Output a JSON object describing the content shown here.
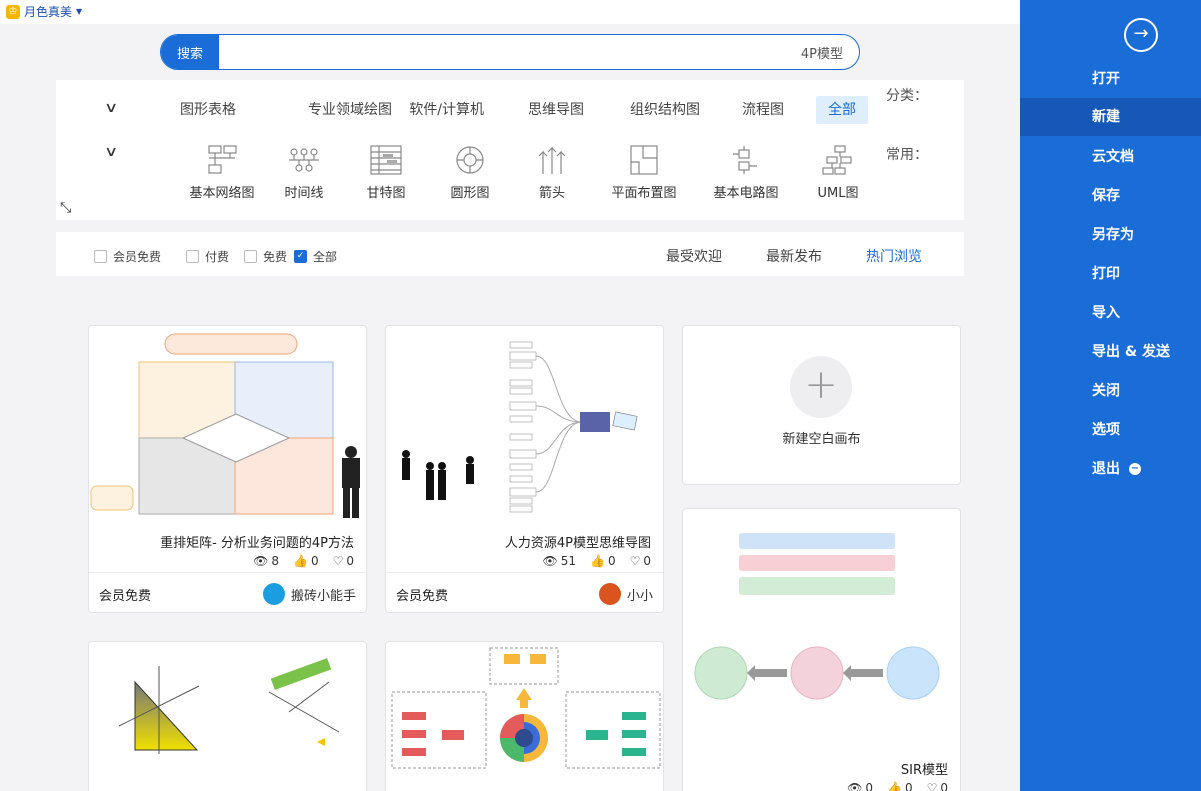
{
  "theme": {
    "label": "月色真美"
  },
  "search": {
    "button": "搜索",
    "value": "4P模型"
  },
  "categories": {
    "label": "分类：",
    "items": [
      "全部",
      "流程图",
      "组织结构图",
      "思维导图",
      "软件/计算机",
      "专业领域绘图",
      "图形表格"
    ]
  },
  "common": {
    "label": "常用：",
    "tools": [
      {
        "label": "UML图",
        "icon": "uml-icon"
      },
      {
        "label": "基本电路图",
        "icon": "circuit-icon"
      },
      {
        "label": "平面布置图",
        "icon": "floorplan-icon"
      },
      {
        "label": "箭头",
        "icon": "arrow-icon"
      },
      {
        "label": "圆形图",
        "icon": "circle-chart-icon"
      },
      {
        "label": "甘特图",
        "icon": "gantt-icon"
      },
      {
        "label": "时间线",
        "icon": "timeline-icon"
      },
      {
        "label": "基本网络图",
        "icon": "network-icon"
      }
    ]
  },
  "sort": {
    "hot": "热门浏览",
    "newest": "最新发布",
    "popular": "最受欢迎"
  },
  "filters": {
    "all": "全部",
    "free": "免费",
    "paid": "付费",
    "member": "会员免费"
  },
  "new_blank": {
    "label": "新建空白画布"
  },
  "cards": [
    {
      "title": "人力资源4P模型思维导图",
      "views": "51",
      "likes": "0",
      "comments": "0",
      "price": "会员免费",
      "author": "小小"
    },
    {
      "title": "重排矩阵- 分析业务问题的4P方法",
      "views": "8",
      "likes": "0",
      "comments": "0",
      "price": "会员免费",
      "author": "搬砖小能手"
    },
    {
      "title": "SIR模型",
      "views": "0",
      "likes": "0",
      "comments": "0"
    }
  ],
  "sidebar": {
    "items": [
      "打开",
      "新建",
      "云文档",
      "保存",
      "另存为",
      "打印",
      "导入",
      "导出 & 发送",
      "关闭",
      "选项",
      "退出"
    ]
  },
  "colors": {
    "accent": "#1a6cd6",
    "sidebar": "#1a6cd6"
  }
}
